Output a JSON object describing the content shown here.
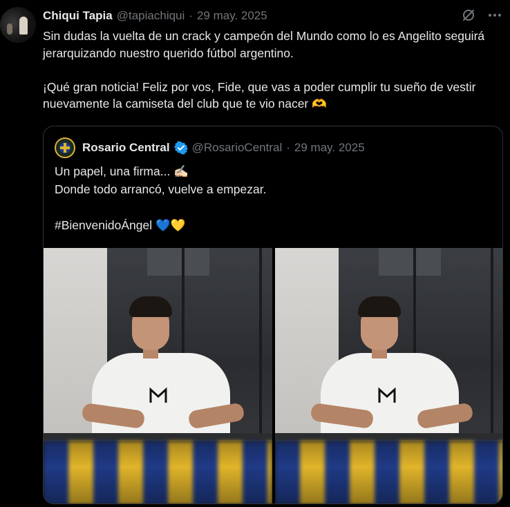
{
  "tweet": {
    "author_name": "Chiqui Tapia",
    "author_handle": "@tapiachiqui",
    "separator": "·",
    "date": "29 may. 2025",
    "text": "Sin dudas la vuelta de un crack y campeón del Mundo como lo es Angelito seguirá jerarquizando nuestro querido fútbol argentino.\n\n¡Qué gran noticia! Feliz por vos, Fide, que vas a poder cumplir tu sueño de vestir nuevamente la camiseta del club que te vio nacer 🫶",
    "icons": [
      "grok-icon",
      "more-icon"
    ]
  },
  "quoted_tweet": {
    "author_name": "Rosario Central",
    "verified": true,
    "author_handle": "@RosarioCentral",
    "separator": "·",
    "date": "29 may. 2025",
    "text": "Un papel, una firma... ✍🏻\nDonde todo arrancó, vuelve a empezar.\n\n#BienvenidoÁngel 💙💛",
    "media_count": 2
  },
  "colors": {
    "background": "#000000",
    "text_primary": "#e7e9ea",
    "text_secondary": "#71767b",
    "border": "#2f3336",
    "verified_blue": "#1d9bf0"
  }
}
